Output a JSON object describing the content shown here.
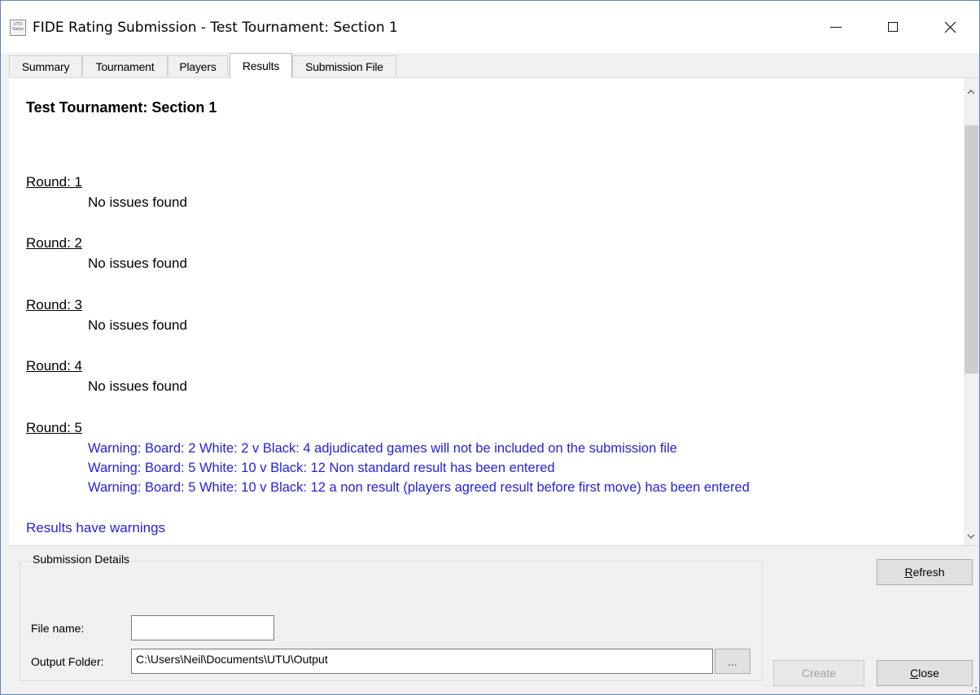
{
  "window": {
    "title": "FIDE Rating Submission - Test Tournament: Section 1",
    "icon_text": "UTU Swiss",
    "controls": {
      "minimize": "minimize-icon",
      "maximize": "maximize-icon",
      "close": "close-icon"
    }
  },
  "tabs": [
    {
      "label": "Summary",
      "active": false
    },
    {
      "label": "Tournament",
      "active": false
    },
    {
      "label": "Players",
      "active": false
    },
    {
      "label": "Results",
      "active": true
    },
    {
      "label": "Submission File",
      "active": false
    }
  ],
  "results": {
    "title": "Test Tournament: Section 1",
    "rounds": [
      {
        "label": "Round: 1",
        "messages": [
          "No issues found"
        ]
      },
      {
        "label": "Round: 2",
        "messages": [
          "No issues found"
        ]
      },
      {
        "label": "Round: 3",
        "messages": [
          "No issues found"
        ]
      },
      {
        "label": "Round: 4",
        "messages": [
          "No issues found"
        ]
      },
      {
        "label": "Round: 5",
        "warnings": [
          "Warning: Board: 2 White: 2 v Black: 4 adjudicated games will not be included on the submission file",
          "Warning: Board: 5 White: 10 v Black: 12 Non standard result has been entered",
          "Warning: Board: 5 White: 10 v Black: 12 a non result (players agreed result before first move) has been entered"
        ]
      }
    ],
    "summary": "Results have warnings"
  },
  "submission": {
    "group_label": "Submission Details",
    "file_name_label": "File name:",
    "file_name_value": "",
    "output_folder_label": "Output Folder:",
    "output_folder_value": "C:\\Users\\Neil\\Documents\\UTU\\Output",
    "browse_label": "..."
  },
  "buttons": {
    "refresh_ul": "R",
    "refresh_rest": "efresh",
    "create": "Create",
    "close_ul": "C",
    "close_rest": "lose"
  },
  "colors": {
    "warning_text": "#2323dd",
    "window_bg": "#f0f0f0",
    "content_bg": "#ffffff"
  }
}
